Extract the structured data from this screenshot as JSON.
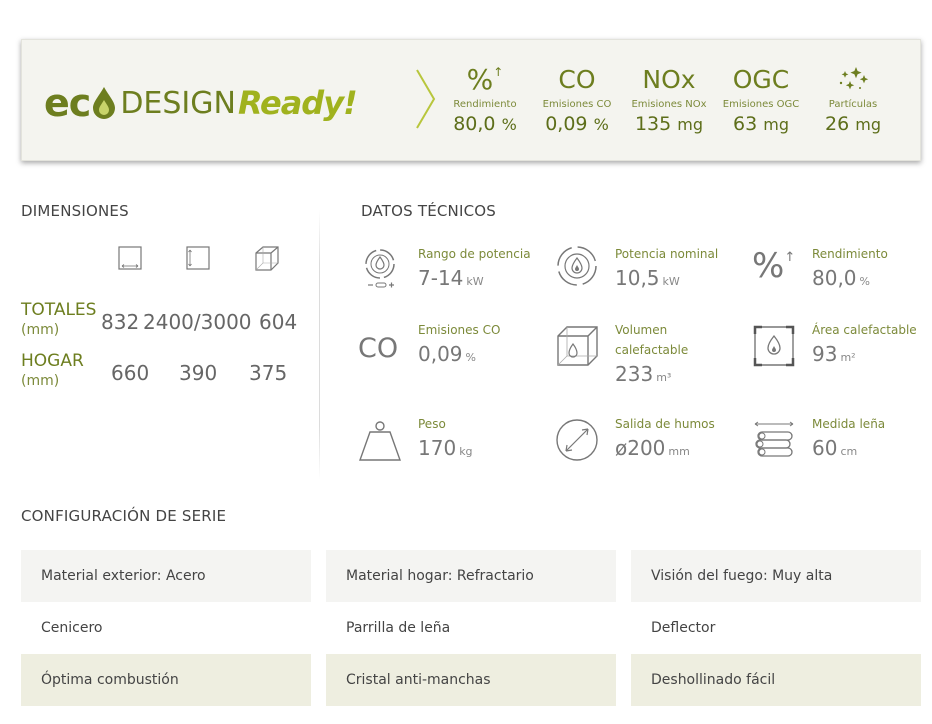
{
  "eco": {
    "logo": {
      "eco": "ec",
      "design": "DESIGN",
      "ready": "Ready!"
    },
    "metrics": [
      {
        "icon": "percent-arrow-icon",
        "symbol": "%",
        "label": "Rendimiento",
        "value": "80,0",
        "unit": "%"
      },
      {
        "icon": "co-icon",
        "symbol": "CO",
        "label": "Emisiones CO",
        "value": "0,09",
        "unit": "%"
      },
      {
        "icon": "nox-icon",
        "symbol": "NOx",
        "label": "Emisiones NOx",
        "value": "135",
        "unit": "mg"
      },
      {
        "icon": "ogc-icon",
        "symbol": "OGC",
        "label": "Emisiones OGC",
        "value": "63",
        "unit": "mg"
      },
      {
        "icon": "particles-icon",
        "symbol": "",
        "label": "Partículas",
        "value": "26",
        "unit": "mg"
      }
    ]
  },
  "dimensions": {
    "title": "DIMENSIONES",
    "icons": [
      "width-icon",
      "height-icon",
      "depth-cube-icon"
    ],
    "rows": [
      {
        "label": "TOTALES",
        "unit": "(mm)",
        "values": [
          "832",
          "2400/3000",
          "604"
        ]
      },
      {
        "label": "HOGAR",
        "unit": "(mm)",
        "values": [
          "660",
          "390",
          "375"
        ]
      }
    ]
  },
  "technical": {
    "title": "DATOS TÉCNICOS",
    "items": [
      {
        "icon": "power-range-icon",
        "label": "Rango de potencia",
        "value": "7-14",
        "unit": "kW"
      },
      {
        "icon": "nominal-power-icon",
        "label": "Potencia nominal",
        "value": "10,5",
        "unit": "kW"
      },
      {
        "icon": "efficiency-icon",
        "label": "Rendimiento",
        "value": "80,0",
        "unit": "%"
      },
      {
        "icon": "co-emission-icon",
        "label": "Emisiones CO",
        "value": "0,09",
        "unit": "%"
      },
      {
        "icon": "heated-volume-icon",
        "label": "Volumen",
        "label2": "calefactable",
        "value": "233",
        "unit": "m³"
      },
      {
        "icon": "heated-area-icon",
        "label": "Área calefactable",
        "value": "93",
        "unit": "m²"
      },
      {
        "icon": "weight-icon",
        "label": "Peso",
        "value": "170",
        "unit": "kg"
      },
      {
        "icon": "flue-outlet-icon",
        "label": "Salida de humos",
        "value": "ø200",
        "unit": "mm"
      },
      {
        "icon": "log-size-icon",
        "label": "Medida leña",
        "value": "60",
        "unit": "cm"
      }
    ]
  },
  "config": {
    "title": "CONFIGURACIÓN DE SERIE",
    "rows": [
      [
        "Material exterior: Acero",
        "Material hogar: Refractario",
        "Visión del fuego: Muy alta"
      ],
      [
        "Cenicero",
        "Parrilla de leña",
        "Deflector"
      ],
      [
        "Óptima combustión",
        "Cristal anti-manchas",
        "Deshollinado fácil"
      ]
    ]
  },
  "colors": {
    "brand_dark": "#6d7e1f",
    "brand_light": "#a0b21e",
    "banner_bg": "#f4f4ef",
    "row_green": "#eeeee0",
    "row_grey": "#f4f4f2"
  }
}
